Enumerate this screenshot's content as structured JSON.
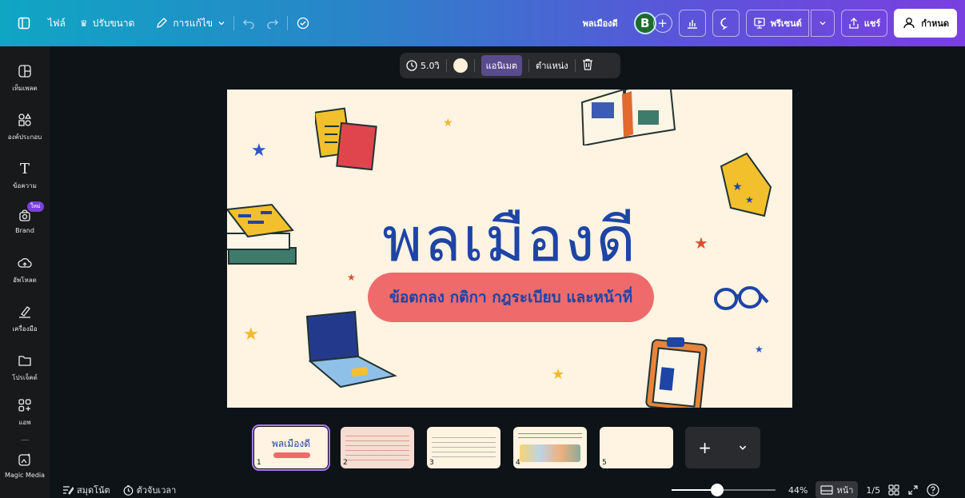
{
  "topbar": {
    "file_label": "ไฟล์",
    "resize_label": "ปรับขนาด",
    "edit_label": "การแก้ไข",
    "doc_title": "พลเมืองดี",
    "avatar_initial": "B",
    "present_label": "พรีเซนต์",
    "share_label": "แชร์",
    "settings_label": "กำหนด"
  },
  "sidebar": {
    "items": [
      {
        "label": "เท็มเพลต",
        "icon": "template-icon"
      },
      {
        "label": "องค์ประกอบ",
        "icon": "elements-icon"
      },
      {
        "label": "ข้อความ",
        "icon": "text-icon"
      },
      {
        "label": "Brand",
        "icon": "brand-icon",
        "badge": "ใหม่"
      },
      {
        "label": "อัพโหลด",
        "icon": "upload-cloud-icon"
      },
      {
        "label": "เครื่องมือ",
        "icon": "draw-tool-icon"
      },
      {
        "label": "โปรเจ็คต์",
        "icon": "folder-icon"
      },
      {
        "label": "แอพ",
        "icon": "apps-icon"
      },
      {
        "label": "Magic Media",
        "icon": "magic-media-icon"
      }
    ]
  },
  "float_toolbar": {
    "duration": "5.0วิ",
    "animate_label": "แอนิเมต",
    "position_label": "ตำแหน่ง"
  },
  "slide": {
    "title": "พลเมืองดี",
    "subtitle": "ข้อตกลง กติกา กฎระเบียบ และหน้าที่"
  },
  "thumbnails": [
    {
      "num": "1",
      "title": "พลเมืองดี"
    },
    {
      "num": "2"
    },
    {
      "num": "3"
    },
    {
      "num": "4"
    },
    {
      "num": "5"
    }
  ],
  "bottombar": {
    "notes_label": "สมุดโน้ต",
    "timer_label": "ตัวจับเวลา",
    "zoom_value": 0.44,
    "zoom_percent": "44%",
    "page_label": "หน้า",
    "page_count": "1/5"
  },
  "colors": {
    "slide_bg": "#fff3e1",
    "title_blue": "#1e44a6",
    "pill_red": "#ef6b6b",
    "accent_purple": "#7b3fe0"
  }
}
